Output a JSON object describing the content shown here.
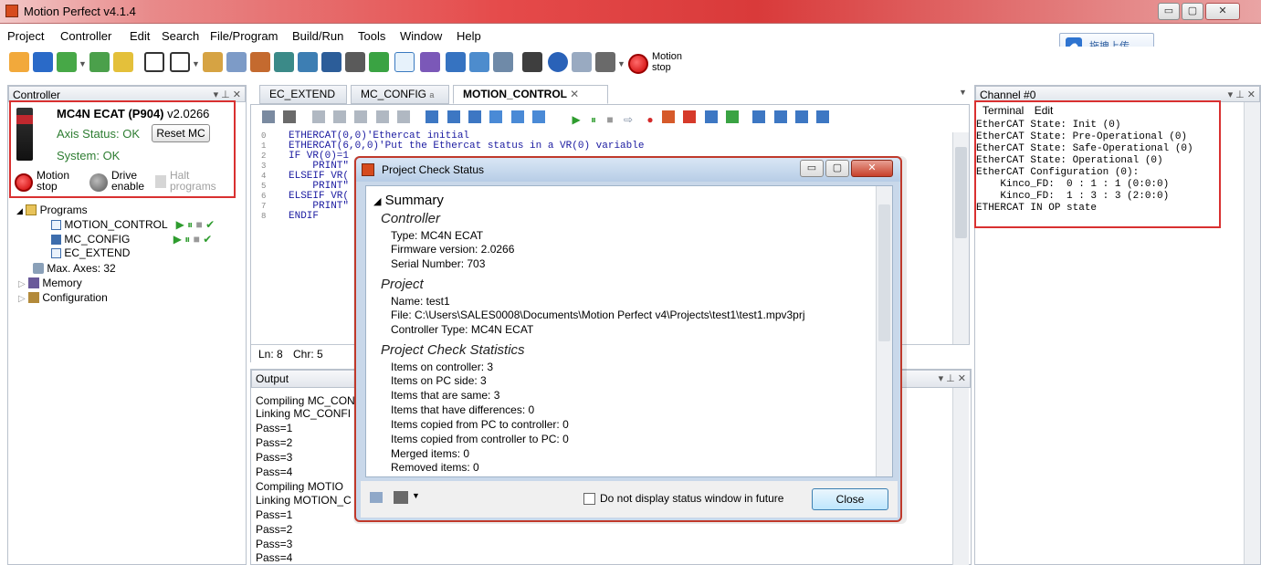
{
  "window": {
    "title": "Motion Perfect v4.1.4",
    "min": "▭",
    "max": "▢",
    "close": "✕"
  },
  "menu": [
    "Project",
    "Controller",
    "Edit",
    "Search",
    "File/Program",
    "Build/Run",
    "Tools",
    "Window",
    "Help"
  ],
  "upload": {
    "label": "拖拽上传",
    "icon": "cloud-upload-icon"
  },
  "toolbar": {
    "motion_stop_line1": "Motion",
    "motion_stop_line2": "stop"
  },
  "controller_panel": {
    "header": "Controller",
    "name": "MC4N ECAT (P904)",
    "version": "v2.0266",
    "axis_status": "Axis Status: OK",
    "reset_label": "Reset MC",
    "system_status": "System: OK",
    "motion_stop": [
      "Motion",
      "stop"
    ],
    "drive_enable": [
      "Drive",
      "enable"
    ],
    "halt_programs": [
      "Halt",
      "programs"
    ],
    "tree": {
      "programs": "Programs",
      "items": [
        "MOTION_CONTROL",
        "MC_CONFIG",
        "EC_EXTEND"
      ],
      "max_axes": "Max. Axes: 32",
      "memory": "Memory",
      "configuration": "Configuration"
    }
  },
  "editor": {
    "tabs": [
      "EC_EXTEND",
      "MC_CONFIG",
      "MOTION_CONTROL"
    ],
    "tab_marker": "a",
    "active_tab_close": "✕",
    "line_numbers": [
      "0",
      "1",
      "2",
      "3",
      "4",
      "5",
      "6",
      "7",
      "8"
    ],
    "code": [
      "ETHERCAT(0,0)'Ethercat initial",
      "ETHERCAT(6,0,0)'Put the Ethercat status in a VR(0) variable",
      "IF VR(0)=1",
      "    PRINT\"",
      "ELSEIF VR(",
      "    PRINT\"",
      "ELSEIF VR(",
      "    PRINT\"",
      "ENDIF"
    ],
    "status_ln": "Ln:  8",
    "status_chr": "Chr:  5"
  },
  "output": {
    "header": "Output",
    "lines": [
      "Compiling MC_CON",
      "Linking MC_CONFI",
      "Pass=1",
      "Pass=2",
      "Pass=3",
      "Pass=4",
      "Compiling MOTIO",
      "Linking MOTION_C",
      "Pass=1",
      "Pass=2",
      "Pass=3",
      "Pass=4"
    ]
  },
  "channel": {
    "header": "Channel #0",
    "menu": [
      "Terminal",
      "Edit"
    ],
    "lines": [
      "EtherCAT State: Init (0)",
      "EtherCAT State: Pre-Operational (0)",
      "EtherCAT State: Safe-Operational (0)",
      "EtherCAT State: Operational (0)",
      "EtherCAT Configuration (0):",
      "    Kinco_FD:  0 : 1 : 1 (0:0:0)",
      "    Kinco_FD:  1 : 3 : 3 (2:0:0)",
      "ETHERCAT IN OP state"
    ]
  },
  "dialog": {
    "title": "Project Check Status",
    "summary": "Summary",
    "sections": {
      "controller": {
        "heading": "Controller",
        "lines": [
          "Type: MC4N ECAT",
          "Firmware version: 2.0266",
          "Serial Number: 703"
        ]
      },
      "project": {
        "heading": "Project",
        "lines": [
          "Name: test1",
          "File: C:\\Users\\SALES0008\\Documents\\Motion Perfect v4\\Projects\\test1\\test1.mpv3prj",
          "Controller Type: MC4N ECAT"
        ]
      },
      "stats": {
        "heading": "Project Check Statistics",
        "lines": [
          "Items on controller: 3",
          "Items on PC side: 3",
          "Items that are same: 3",
          "Items that have differences: 0",
          "Items copied from PC to controller: 0",
          "Items copied from controller to PC: 0",
          "Merged items: 0",
          "Removed items: 0"
        ]
      }
    },
    "checkbox_label": "Do not display status window in future",
    "close_label": "Close"
  }
}
